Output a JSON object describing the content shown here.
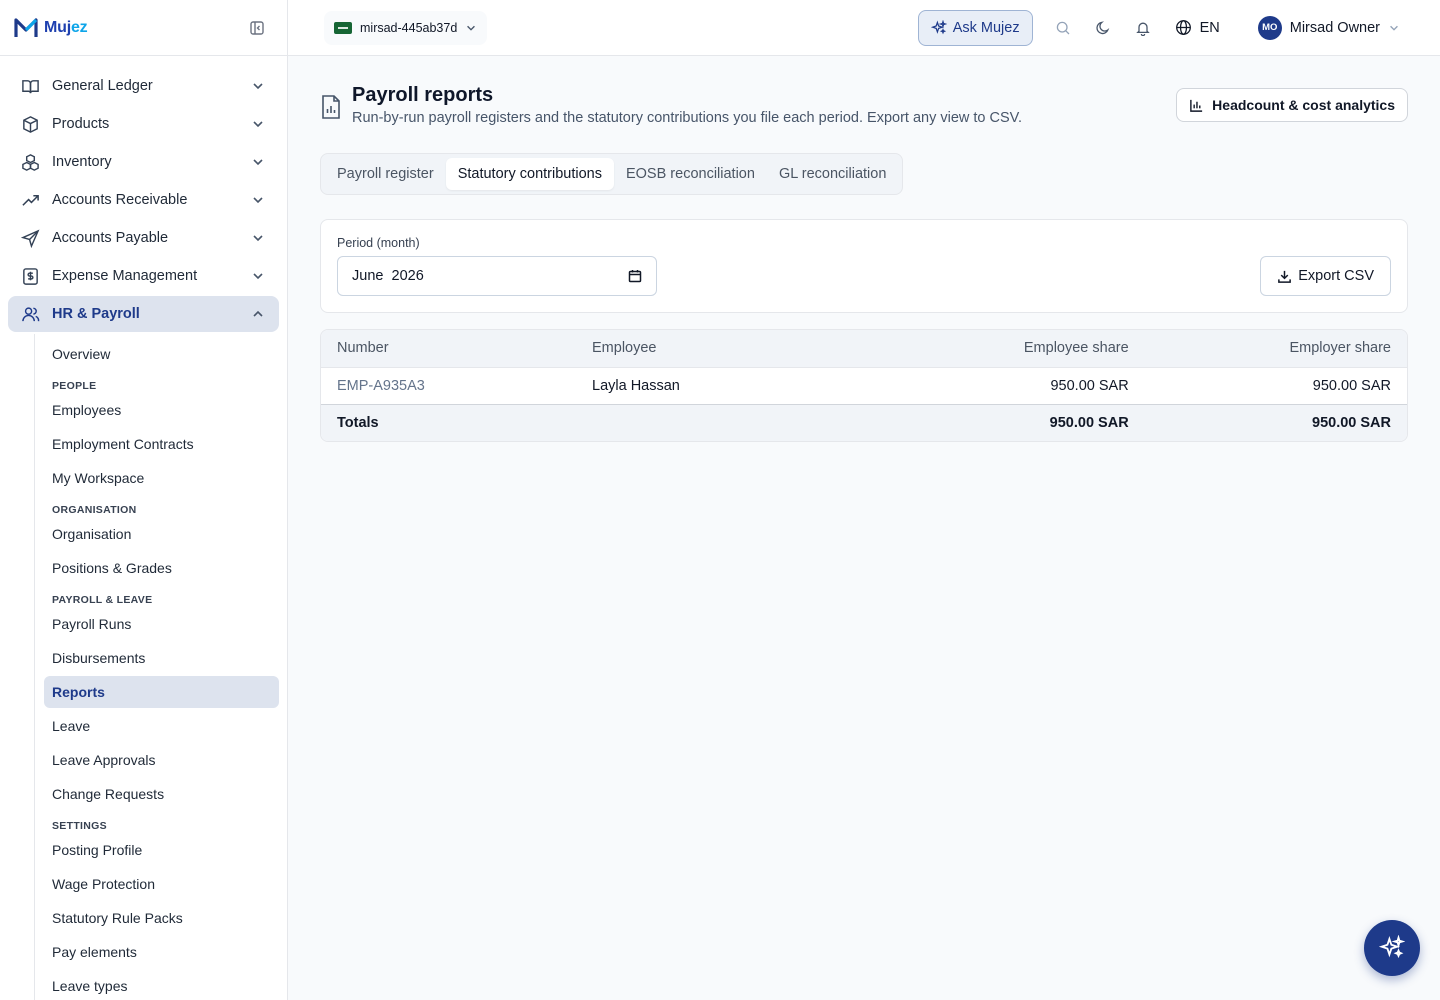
{
  "brand": {
    "name_main": "Muj",
    "name_accent": "ez"
  },
  "nav": [
    {
      "label": "General Ledger",
      "icon": "book-open-icon"
    },
    {
      "label": "Products",
      "icon": "box-icon"
    },
    {
      "label": "Inventory",
      "icon": "boxes-icon"
    },
    {
      "label": "Accounts Receivable",
      "icon": "trending-up-icon"
    },
    {
      "label": "Accounts Payable",
      "icon": "send-icon"
    },
    {
      "label": "Expense Management",
      "icon": "receipt-icon"
    },
    {
      "label": "HR & Payroll",
      "icon": "users-icon"
    }
  ],
  "hr_sub": {
    "overview": "Overview",
    "section_people": "PEOPLE",
    "employees": "Employees",
    "employment_contracts": "Employment Contracts",
    "my_workspace": "My Workspace",
    "section_org": "ORGANISATION",
    "organisation": "Organisation",
    "positions_grades": "Positions & Grades",
    "section_payroll": "PAYROLL & LEAVE",
    "payroll_runs": "Payroll Runs",
    "disbursements": "Disbursements",
    "reports": "Reports",
    "leave": "Leave",
    "leave_approvals": "Leave Approvals",
    "change_requests": "Change Requests",
    "section_settings": "SETTINGS",
    "posting_profile": "Posting Profile",
    "wage_protection": "Wage Protection",
    "statutory_rule_packs": "Statutory Rule Packs",
    "pay_elements": "Pay elements",
    "leave_types": "Leave types"
  },
  "topbar": {
    "tenant": "mirsad-445ab37d",
    "ask_label": "Ask Mujez",
    "lang": "EN",
    "user_initials": "MO",
    "user_name": "Mirsad Owner"
  },
  "page": {
    "title": "Payroll reports",
    "subtitle": "Run-by-run payroll registers and the statutory contributions you file each period. Export any view to CSV.",
    "analytics_label": "Headcount & cost analytics"
  },
  "tabs": [
    "Payroll register",
    "Statutory contributions",
    "EOSB reconciliation",
    "GL reconciliation"
  ],
  "active_tab": "Statutory contributions",
  "filter": {
    "period_label": "Period (month)",
    "period_value": "June  2026",
    "export_label": "Export CSV"
  },
  "table": {
    "headers": [
      "Number",
      "Employee",
      "Employee share",
      "Employer share"
    ],
    "rows": [
      {
        "number": "EMP-A935A3",
        "employee": "Layla Hassan",
        "employee_share": "950.00 SAR",
        "employer_share": "950.00 SAR"
      }
    ],
    "totals": {
      "label": "Totals",
      "employee_share": "950.00 SAR",
      "employer_share": "950.00 SAR"
    }
  },
  "colors": {
    "primary": "#1e3a8a",
    "accent": "#0ea5e9",
    "active_bg": "#dde3ee"
  }
}
